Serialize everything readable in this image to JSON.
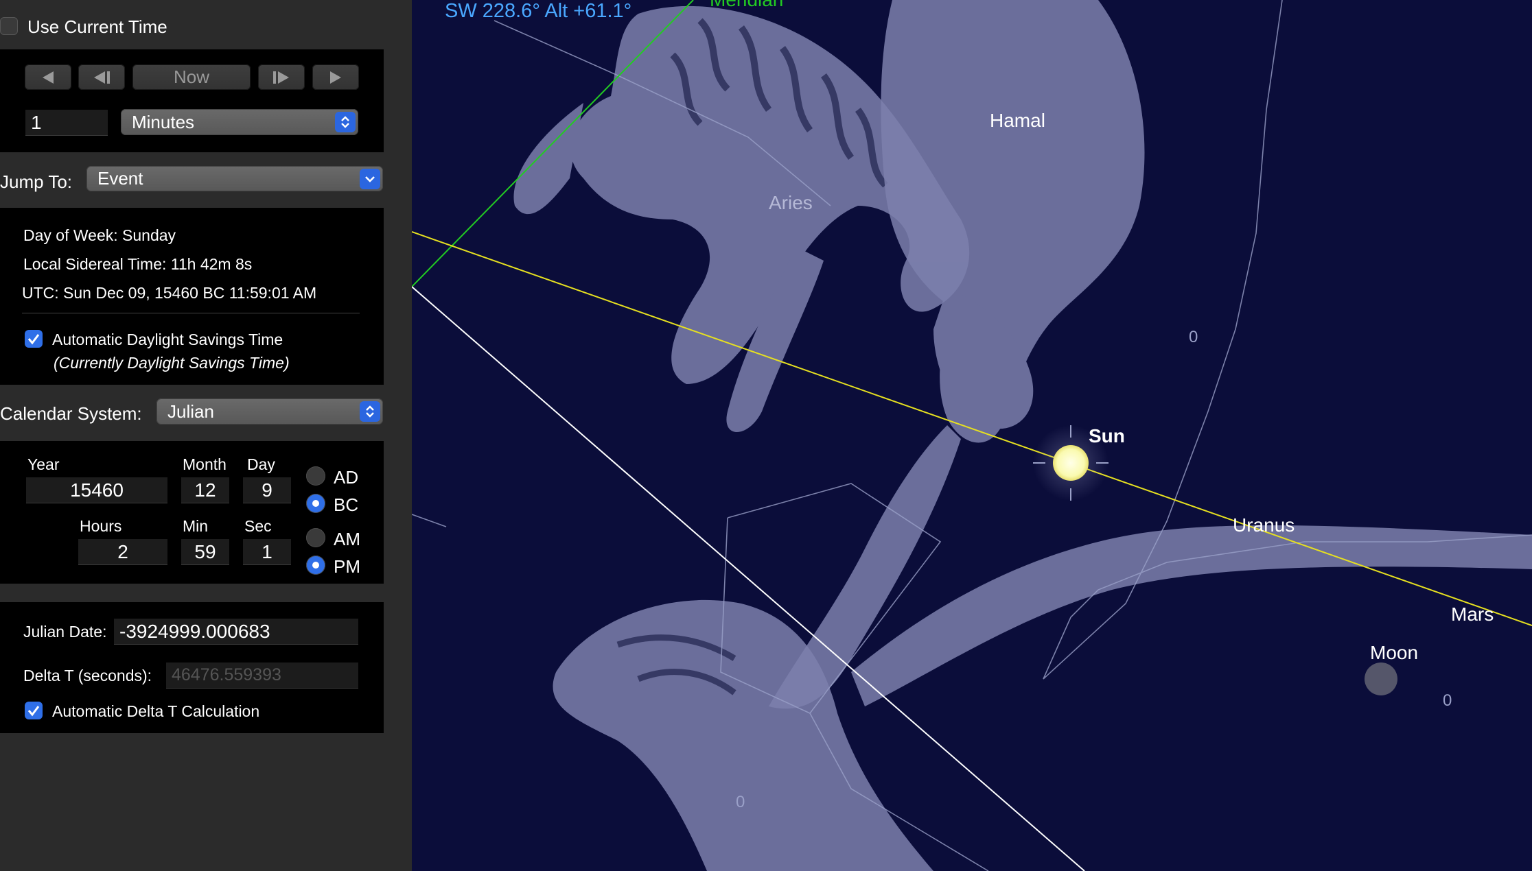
{
  "time_controls": {
    "use_current_time_label": "Use Current Time",
    "use_current_time_checked": false,
    "step_back_icon": "triangle-left-icon",
    "step_back_frame_icon": "step-back-icon",
    "now_label": "Now",
    "step_forward_frame_icon": "step-forward-icon",
    "step_forward_icon": "triangle-right-icon",
    "step_value": "1",
    "step_unit": "Minutes"
  },
  "jump_to": {
    "label": "Jump To:",
    "value": "Event"
  },
  "info": {
    "day_of_week": "Day of Week:  Sunday",
    "sidereal_time": "Local Sidereal Time:  11h 42m 8s",
    "utc": "UTC:  Sun Dec 09, 15460 BC 11:59:01 AM",
    "dst_label": "Automatic Daylight Savings Time",
    "dst_checked": true,
    "dst_status": "(Currently Daylight Savings Time)"
  },
  "calendar": {
    "label": "Calendar System:",
    "value": "Julian"
  },
  "date_fields": {
    "year_label": "Year",
    "year": "15460",
    "month_label": "Month",
    "month": "12",
    "day_label": "Day",
    "day": "9",
    "ad_label": "AD",
    "bc_label": "BC",
    "era_selected": "BC",
    "hours_label": "Hours",
    "hours": "2",
    "min_label": "Min",
    "min": "59",
    "sec_label": "Sec",
    "sec": "1",
    "am_label": "AM",
    "pm_label": "PM",
    "meridiem_selected": "PM"
  },
  "julian": {
    "julian_date_label": "Julian Date:",
    "julian_date": "-3924999.000683",
    "delta_t_label": "Delta T (seconds):",
    "delta_t": "46476.559393",
    "auto_delta_t_label": "Automatic Delta T Calculation",
    "auto_delta_t_checked": true
  },
  "sky": {
    "pointing": "SW 228.6° Alt +61.1°",
    "meridian_label": "Meridian",
    "labels": {
      "hamal": "Hamal",
      "aries": "Aries",
      "sun": "Sun",
      "uranus": "Uranus",
      "mars": "Mars",
      "moon": "Moon",
      "zero_a": "0",
      "zero_b": "0",
      "zero_c": "0"
    },
    "colors": {
      "background": "#0b0d3a",
      "ecliptic": "#e6e020",
      "meridian": "#22cc22",
      "pointing_text": "#4aa8ff",
      "horizon_line": "#ffffff"
    }
  }
}
